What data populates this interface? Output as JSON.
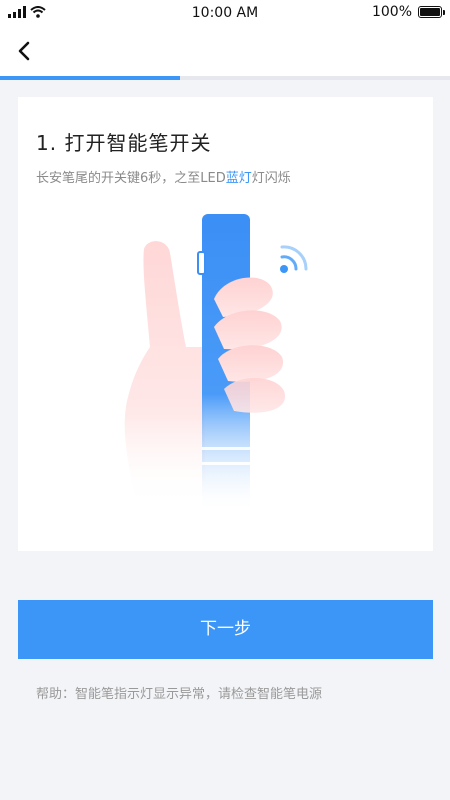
{
  "status_bar": {
    "time": "10:00 AM",
    "battery": "100%"
  },
  "progress": {
    "fraction": 0.4
  },
  "step": {
    "title": "1. 打开智能笔开关",
    "desc_prefix": "长安笔尾的开关键6秒，之至LED",
    "desc_highlight": "蓝灯",
    "desc_suffix": "灯闪烁"
  },
  "illustration": {
    "icon": "hand-holding-pen"
  },
  "actions": {
    "next_label": "下一步"
  },
  "help": {
    "text": "帮助：智能笔指示灯显示异常，请检查智能笔电源"
  },
  "colors": {
    "accent": "#3b96f7",
    "background": "#f3f4f7",
    "hand": "#ffe1e1"
  }
}
